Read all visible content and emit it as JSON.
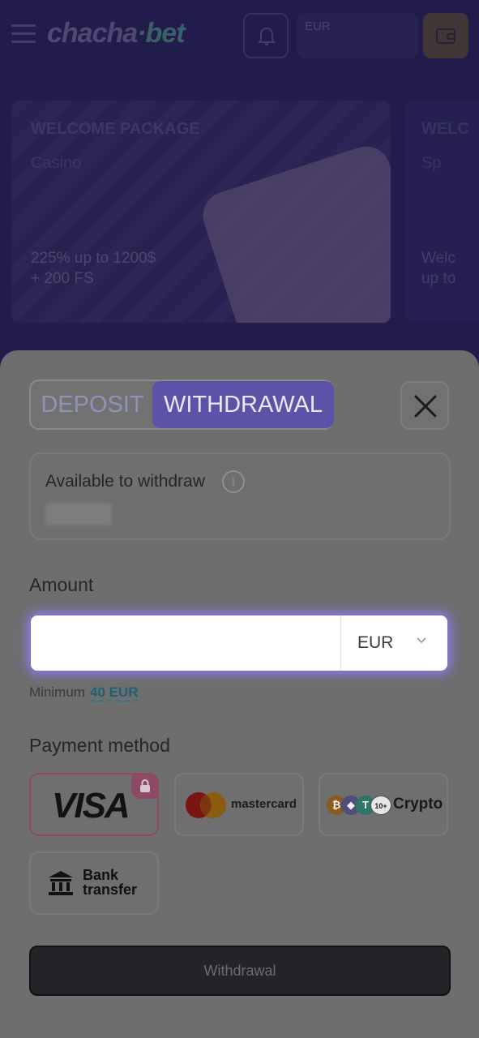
{
  "header": {
    "logo_main": "chacha",
    "logo_accent": "bet",
    "balance_currency": "EUR"
  },
  "banners": [
    {
      "title": "WELCOME PACKAGE",
      "subtitle": "Casino",
      "offer_line1": "225% up to 1200$",
      "offer_line2": "+ 200 FS"
    },
    {
      "title": "WELC",
      "subtitle": "Sp",
      "offer_line1": "Welc",
      "offer_line2": "up to"
    }
  ],
  "modal": {
    "tabs": [
      {
        "label": "DEPOSIT",
        "active": false
      },
      {
        "label": "WITHDRAWAL",
        "active": true
      }
    ],
    "available_label": "Available to withdraw",
    "info_icon": "i",
    "amount_label": "Amount",
    "amount_value": "",
    "currency": "EUR",
    "minimum_label": "Minimum",
    "minimum_value": "40 EUR",
    "payment_label": "Payment method",
    "methods": [
      {
        "id": "visa",
        "label": "VISA",
        "locked": true,
        "selected": true
      },
      {
        "id": "mastercard",
        "label": "mastercard"
      },
      {
        "id": "crypto",
        "label": "Crypto",
        "coin_badge": "10+"
      },
      {
        "id": "bank",
        "label_line1": "Bank",
        "label_line2": "transfer"
      }
    ],
    "submit_label": "Withdrawal"
  },
  "icons": {
    "menu": "hamburger-icon",
    "bell": "bell-icon",
    "wallet": "wallet-icon",
    "close": "close-icon",
    "lock": "lock-icon",
    "chevron": "chevron-down-icon",
    "bank": "bank-icon"
  },
  "colors": {
    "accent": "#5b53a8",
    "link": "#1f5f73",
    "selected_border": "#8a4964"
  }
}
